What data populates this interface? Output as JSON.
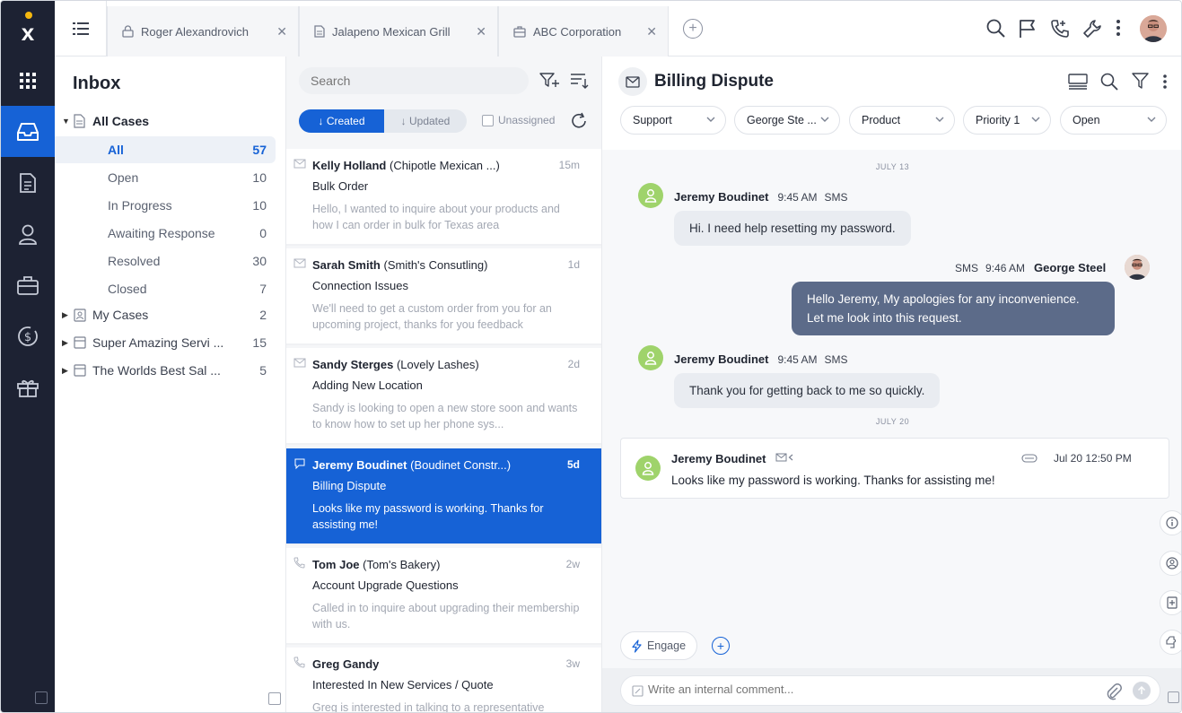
{
  "tabs": [
    {
      "label": "Roger Alexandrovich",
      "icon": "lock-icon"
    },
    {
      "label": "Jalapeno Mexican Grill",
      "icon": "document-icon"
    },
    {
      "label": "ABC Corporation",
      "icon": "briefcase-icon"
    }
  ],
  "tab_close": "✕",
  "inbox": {
    "title": "Inbox",
    "all_cases": "All Cases",
    "statuses": [
      {
        "label": "All",
        "count": "57"
      },
      {
        "label": "Open",
        "count": "10"
      },
      {
        "label": "In Progress",
        "count": "10"
      },
      {
        "label": "Awaiting Response",
        "count": "0"
      },
      {
        "label": "Resolved",
        "count": "30"
      },
      {
        "label": "Closed",
        "count": "7"
      }
    ],
    "groups": [
      {
        "label": "My Cases",
        "count": "2"
      },
      {
        "label": "Super Amazing Servi ...",
        "count": "15"
      },
      {
        "label": "The Worlds Best Sal ...",
        "count": "5"
      }
    ]
  },
  "list": {
    "search_placeholder": "Search",
    "created_label": "↓ Created",
    "updated_label": "↓ Updated",
    "unassigned_label": "Unassigned",
    "cases": [
      {
        "name": "Kelly Holland",
        "company": "(Chipotle Mexican ...)",
        "time": "15m",
        "subject": "Bulk Order",
        "preview": "Hello, I wanted to inquire about your products and how I can order in bulk for Texas area"
      },
      {
        "name": "Sarah Smith",
        "company": "(Smith's Consutling)",
        "time": "1d",
        "subject": "Connection Issues",
        "preview": "We'll need to get a custom order from you for an upcoming project, thanks for you feedback"
      },
      {
        "name": "Sandy Sterges",
        "company": "(Lovely Lashes)",
        "time": "2d",
        "subject": "Adding New Location",
        "preview": "Sandy is looking to open a new store soon and wants to know how to set up her phone sys..."
      },
      {
        "name": "Jeremy Boudinet",
        "company": "(Boudinet Constr...)",
        "time": "5d",
        "subject": "Billing Dispute",
        "preview": "Looks like my password is working. Thanks for assisting me!"
      },
      {
        "name": "Tom Joe",
        "company": "(Tom's Bakery)",
        "time": "2w",
        "subject": "Account Upgrade Questions",
        "preview": "Called in to inquire about upgrading their membership with us."
      },
      {
        "name": "Greg Gandy",
        "company": "",
        "time": "3w",
        "subject": "Interested In New Services / Quote",
        "preview": "Greg is interested in talking to a representative"
      }
    ]
  },
  "conversation": {
    "title": "Billing Dispute",
    "filters": [
      "Support",
      "George Ste ...",
      "Product",
      "Priority 1",
      "Open"
    ],
    "date1": "JULY 13",
    "date2": "JULY 20",
    "messages": [
      {
        "sender": "Jeremy Boudinet",
        "time": "9:45 AM",
        "channel": "SMS",
        "text": "Hi. I need help resetting my password."
      },
      {
        "sender": "George Steel",
        "time": "9:46 AM",
        "channel": "SMS",
        "text": "Hello Jeremy, My apologies for any inconvenience. Let me look into this request."
      },
      {
        "sender": "Jeremy Boudinet",
        "time": "9:45 AM",
        "channel": "SMS",
        "text": "Thank you for getting back to me so quickly."
      }
    ],
    "email": {
      "sender": "Jeremy Boudinet",
      "date": "Jul 20 12:50 PM",
      "text": "Looks like my password is working. Thanks for assisting me!"
    },
    "engage_label": "Engage",
    "compose_placeholder": "Write an internal comment..."
  },
  "colors": {
    "rail": "#1d2233",
    "accent": "#1662d6",
    "avatar_green": "#9fd36b",
    "outgoing_bubble": "#5c6b89"
  }
}
